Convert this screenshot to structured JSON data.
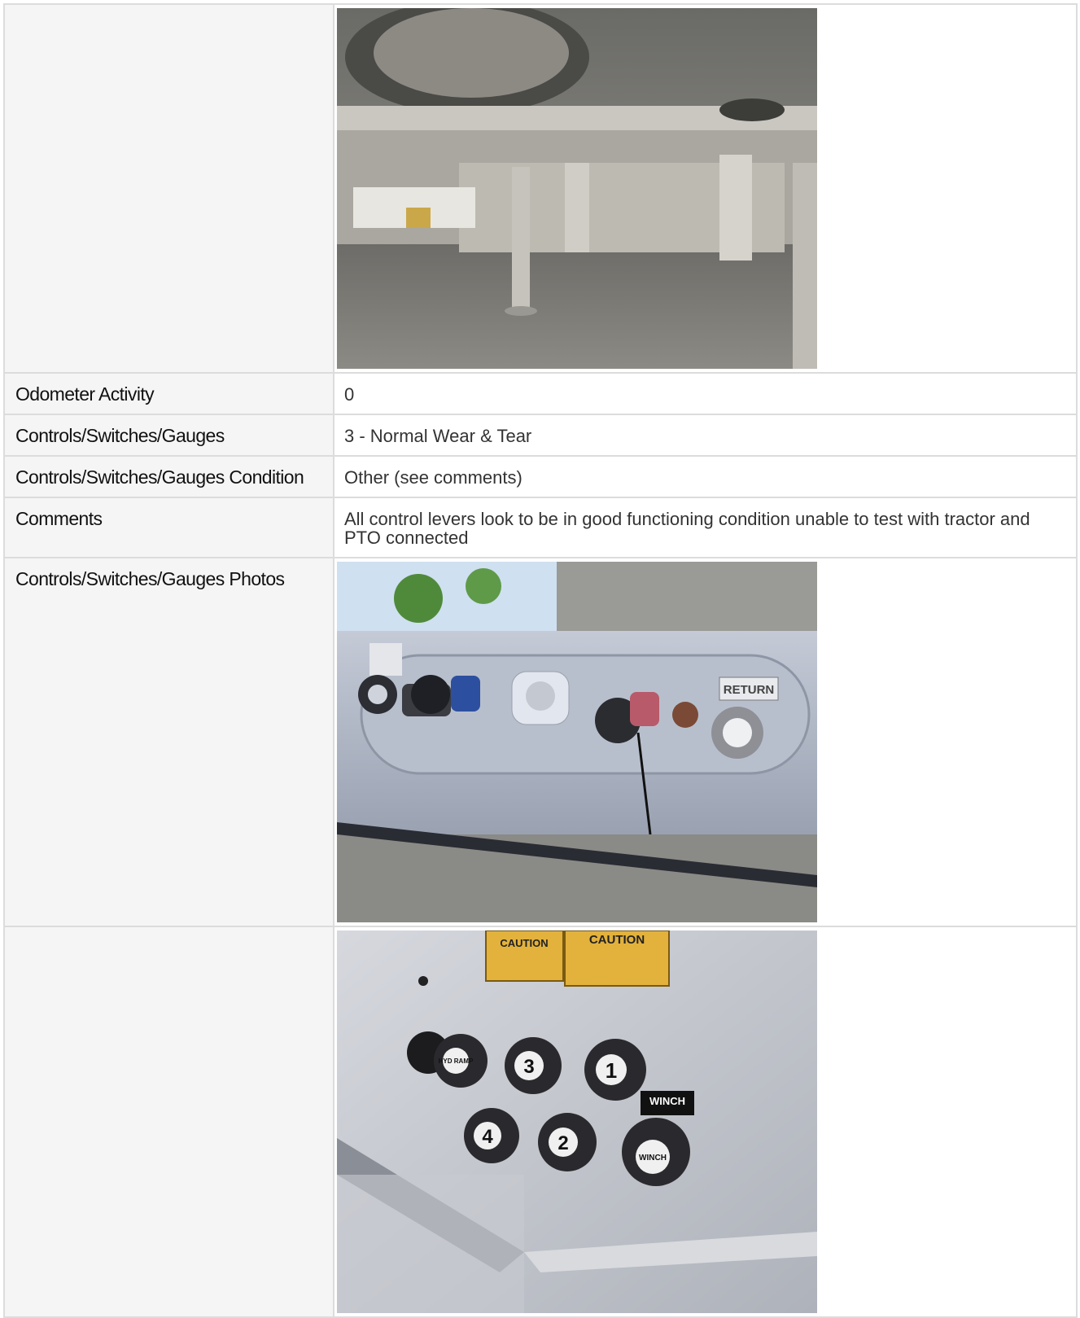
{
  "rows": [
    {
      "label": "",
      "type": "photo",
      "photo": "trailer-undercarriage-photo"
    },
    {
      "label": "Odometer Activity",
      "value": "0"
    },
    {
      "label": "Controls/Switches/Gauges",
      "value": "3 - Normal Wear & Tear"
    },
    {
      "label": "Controls/Switches/Gauges Condition",
      "value": "Other (see comments)"
    },
    {
      "label": "Comments",
      "value": "All control levers look to be in good functioning condition unable to test with tractor and PTO connected"
    },
    {
      "label": "Controls/Switches/Gauges Photos",
      "type": "photo",
      "photo": "glad-hands-connector-panel-photo"
    },
    {
      "label": "",
      "type": "photo",
      "photo": "control-knobs-panel-photo"
    }
  ],
  "photo2": {
    "return_label": "RETURN"
  },
  "photo3": {
    "caution_left": "CAUTION",
    "caution_right": "CAUTION",
    "knob_1": "1",
    "knob_2": "2",
    "knob_3": "3",
    "knob_4": "4",
    "knob_hyd": "HYD RAMP",
    "knob_winch": "WINCH",
    "winch_tag": "WINCH"
  }
}
